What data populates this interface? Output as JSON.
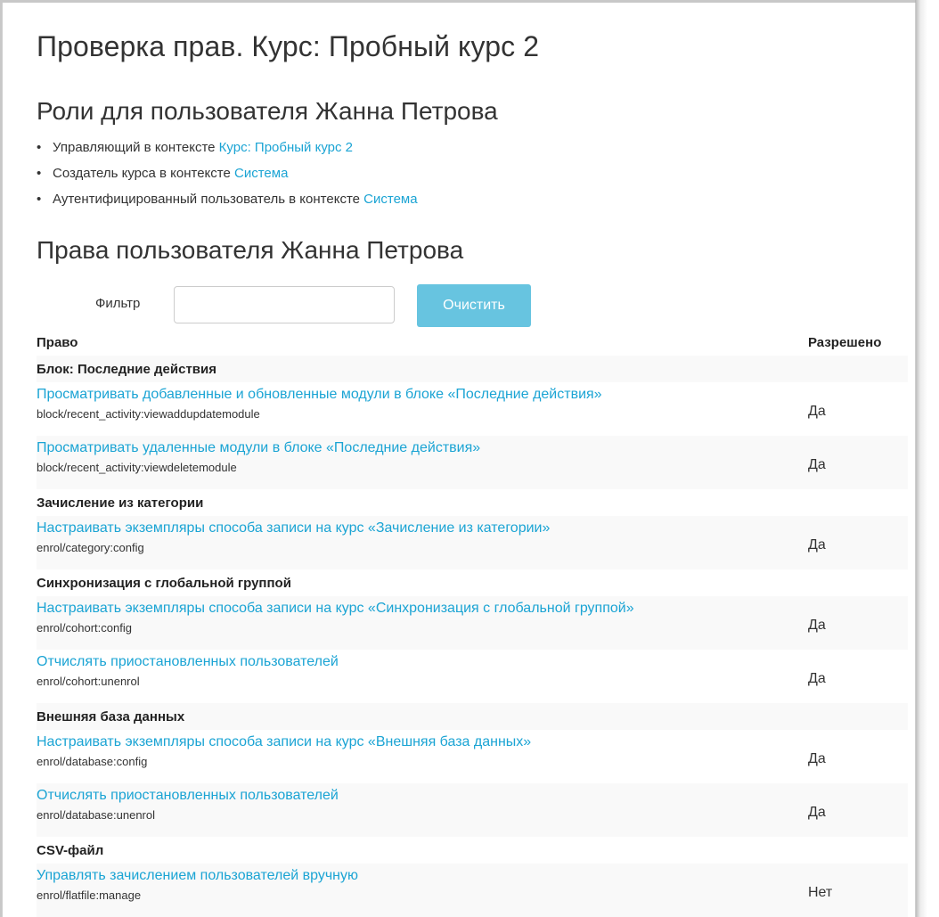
{
  "page_title": "Проверка прав. Курс: Пробный курс 2",
  "roles_heading": "Роли для пользователя Жанна Петрова",
  "roles": [
    {
      "bullet": "•",
      "text": "Управляющий в контексте",
      "context": "Курс: Пробный курс 2"
    },
    {
      "bullet": "•",
      "text": "Создатель курса в контексте",
      "context": "Система"
    },
    {
      "bullet": "•",
      "text": "Аутентифицированный пользователь в контексте",
      "context": "Система"
    }
  ],
  "capabilities_heading": "Права пользователя Жанна Петрова",
  "filter": {
    "label": "Фильтр",
    "value": "",
    "placeholder": "",
    "clear_label": "Очистить"
  },
  "table": {
    "col_capability": "Право",
    "col_allowed": "Разрешено",
    "groups": [
      {
        "title": "Блок: Последние действия",
        "rows": [
          {
            "name": "Просматривать добавленные и обновленные модули в блоке «Последние действия»",
            "code": "block/recent_activity:viewaddupdatemodule",
            "allowed": "Да"
          },
          {
            "name": "Просматривать удаленные модули в блоке «Последние действия»",
            "code": "block/recent_activity:viewdeletemodule",
            "allowed": "Да"
          }
        ]
      },
      {
        "title": "Зачисление из категории",
        "rows": [
          {
            "name": "Настраивать экземпляры способа записи на курс «Зачисление из категории»",
            "code": "enrol/category:config",
            "allowed": "Да"
          }
        ]
      },
      {
        "title": "Синхронизация с глобальной группой",
        "rows": [
          {
            "name": "Настраивать экземпляры способа записи на курс «Синхронизация с глобальной группой»",
            "code": "enrol/cohort:config",
            "allowed": "Да"
          },
          {
            "name": "Отчислять приостановленных пользователей",
            "code": "enrol/cohort:unenrol",
            "allowed": "Да"
          }
        ]
      },
      {
        "title": "Внешняя база данных",
        "rows": [
          {
            "name": "Настраивать экземпляры способа записи на курс «Внешняя база данных»",
            "code": "enrol/database:config",
            "allowed": "Да"
          },
          {
            "name": "Отчислять приостановленных пользователей",
            "code": "enrol/database:unenrol",
            "allowed": "Да"
          }
        ]
      },
      {
        "title": "CSV-файл",
        "rows": [
          {
            "name": "Управлять зачислением пользователей вручную",
            "code": "enrol/flatfile:manage",
            "allowed": "Нет"
          }
        ]
      }
    ]
  },
  "colors": {
    "link": "#1ba4d4",
    "button": "#5bc0de",
    "row_shade": "#f9f9f9"
  }
}
